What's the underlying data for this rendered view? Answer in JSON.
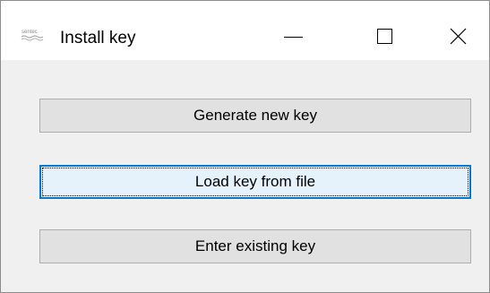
{
  "window": {
    "title": "Install key",
    "app_icon": "sentec-logo-icon",
    "app_icon_text": "sentec",
    "controls": {
      "minimize": "minimize-icon",
      "maximize": "maximize-icon",
      "close": "close-icon"
    }
  },
  "buttons": [
    {
      "label": "Generate new key",
      "focused": false
    },
    {
      "label": "Load key from file",
      "focused": true
    },
    {
      "label": "Enter existing key",
      "focused": false
    }
  ],
  "colors": {
    "window_bg": "#f0f0f0",
    "titlebar_bg": "#ffffff",
    "button_bg": "#e1e1e1",
    "button_border": "#adadad",
    "focused_bg": "#e5f1fb",
    "focused_border": "#0078d7"
  }
}
